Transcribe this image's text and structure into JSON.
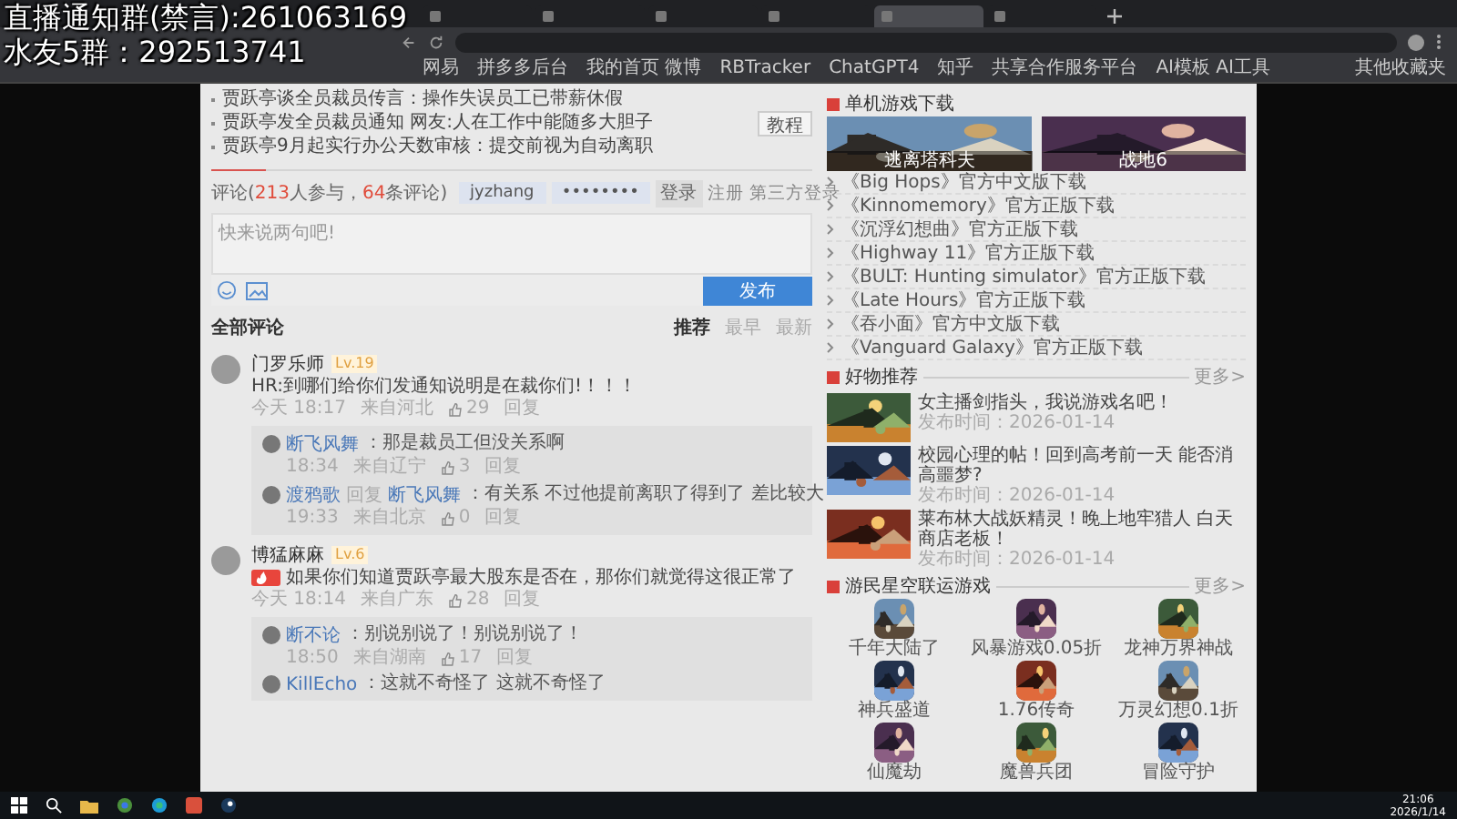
{
  "overlay": [
    "直播通知群(禁言):261063169",
    "水友5群：292513741"
  ],
  "browser": {
    "tabs": [
      {
        "selected": false
      },
      {
        "selected": false
      },
      {
        "selected": false
      },
      {
        "selected": false
      },
      {
        "selected": true
      },
      {
        "selected": false
      }
    ],
    "bookmarks": [
      "网易",
      "拼多多后台",
      "我的首页 微博",
      "RBTracker",
      "ChatGPT4",
      "知乎",
      "共享合作服务平台",
      "AI模板 AI工具"
    ],
    "other_bookmarks": "其他收藏夹"
  },
  "articles": [
    "贾跃亭谈全员裁员传言：操作失误员工已带薪休假",
    "贾跃亭发全员裁员通知 网友:人在工作中能随多大胆子",
    "贾跃亭9月起实行办公天数审核：提交前视为自动离职"
  ],
  "tutorial_button": "教程",
  "comment_box": {
    "title": [
      {
        "text": "评论(",
        "highlight": false
      },
      {
        "text": "213",
        "highlight": true
      },
      {
        "text": "人参与，",
        "highlight": false
      },
      {
        "text": "64",
        "highlight": true
      },
      {
        "text": "条评论)",
        "highlight": false
      }
    ],
    "username": "jyzhang",
    "password": "••••••••",
    "login": "登录",
    "links": [
      "注册",
      "第三方登录"
    ],
    "placeholder": "快来说两句吧!",
    "publish": "发布"
  },
  "comments_header": "全部评论",
  "sort_tabs": [
    {
      "label": "推荐",
      "selected": true
    },
    {
      "label": "最早",
      "selected": false
    },
    {
      "label": "最新",
      "selected": false
    }
  ],
  "comments": [
    {
      "user": "门罗乐师",
      "level": "Lv.19",
      "hot": false,
      "text": "HR:到哪们给你们发通知说明是在裁你们!！！！",
      "time": "今天 18:17",
      "location": "来自河北",
      "likes": "29",
      "reply": "回复",
      "replies": [
        {
          "user": "断飞风舞",
          "text": "：那是裁员工但没关系啊",
          "time": "18:34",
          "location": "来自辽宁",
          "likes": "3",
          "reply": "回复"
        },
        {
          "user": "渡鸦歌",
          "reply_word": "回复",
          "reply_to": "断飞风舞",
          "text": "：有关系 不过他提前离职了得到了 差比较大",
          "time": "19:33",
          "location": "来自北京",
          "likes": "0",
          "reply": "回复"
        }
      ]
    },
    {
      "user": "博猛麻麻",
      "level": "Lv.6",
      "hot": true,
      "text": "如果你们知道贾跃亭最大股东是否在，那你们就觉得这很正常了",
      "time": "今天 18:14",
      "location": "来自广东",
      "likes": "28",
      "reply": "回复",
      "replies": [
        {
          "user": "断不论",
          "text": "：别说别说了！别说别说了！",
          "time": "18:50",
          "location": "来自湖南",
          "likes": "17",
          "reply": "回复"
        },
        {
          "user": "KillEcho",
          "text": "：这就不奇怪了 这就不奇怪了"
        }
      ]
    }
  ],
  "downloads": {
    "title": "单机游戏下载",
    "featured": [
      {
        "caption": "逃离塔科夫"
      },
      {
        "caption": "战地6"
      }
    ],
    "items": [
      "《Big Hops》官方中文版下载",
      "《Kinnomemory》官方正版下载",
      "《沉浮幻想曲》官方正版下载",
      "《Highway 11》官方正版下载",
      "《BULT: Hunting simulator》官方正版下载",
      "《Late Hours》官方正版下载",
      "《吞小面》官方中文版下载",
      "《Vanguard Galaxy》官方正版下载"
    ]
  },
  "goods": {
    "title": "好物推荐",
    "more": "更多>",
    "items": [
      {
        "title": "女主播剑指头，我说游戏名吧！",
        "date": "发布时间：2026-01-14"
      },
      {
        "title": "校园心理的帖！回到高考前一天 能否消高噩梦?",
        "date": "发布时间：2026-01-14"
      },
      {
        "title": "莱布林大战妖精灵！晚上地牢猎人 白天商店老板！",
        "date": "发布时间：2026-01-14"
      }
    ]
  },
  "games": {
    "title": "游民星空联运游戏",
    "more": "更多>",
    "items": [
      "千年大陆了",
      "风暴游戏0.05折",
      "龙神万界神战",
      "神兵盛道",
      "1.76传奇",
      "万灵幻想0.1折",
      "仙魔劫",
      "魔兽兵团",
      "冒险守护"
    ]
  },
  "taskbar": {
    "time": "21:06",
    "date": "2026/1/14"
  }
}
